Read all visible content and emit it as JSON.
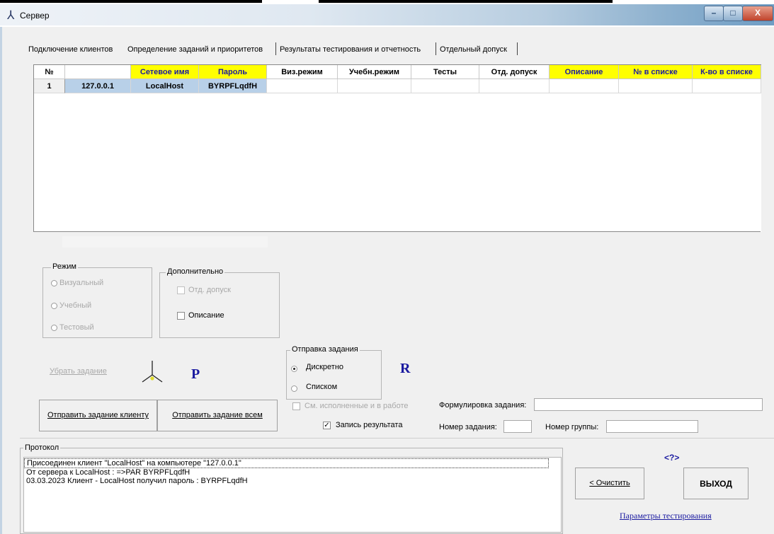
{
  "window": {
    "title": "Сервер",
    "controls": [
      "–",
      "□",
      "X"
    ]
  },
  "tabs": [
    "Подключение клиентов",
    "Определение заданий и приоритетов",
    "Результаты тестирования и отчетность",
    "Отдельный допуск"
  ],
  "grid": {
    "columns": [
      "№",
      "",
      "Сетевое имя",
      "Пароль",
      "Виз.режим",
      "Учебн.режим",
      "Тесты",
      "Отд. допуск",
      "Описание",
      "№ в списке",
      "К-во в списке"
    ],
    "highlighted_columns": [
      "Сетевое имя",
      "Пароль",
      "Описание",
      "№ в списке",
      "К-во в списке"
    ],
    "rows": [
      [
        "1",
        "127.0.0.1",
        "LocalHost",
        "BYRPFLqdfH",
        "",
        "",
        "",
        "",
        "",
        "",
        ""
      ]
    ]
  },
  "mode_group": {
    "legend": "Режим",
    "options": [
      "Визуальный",
      "Учебный",
      "Тестовый"
    ]
  },
  "extra_group": {
    "legend": "Дополнительно",
    "options": [
      "Отд. допуск",
      "Описание"
    ]
  },
  "send_group": {
    "legend": "Отправка задания",
    "options": [
      "Дискретно",
      "Списком"
    ],
    "selected": "Дискретно"
  },
  "remove_task_label": "Убрать задание",
  "p_marker": "P",
  "r_marker": "R",
  "send_client_button": "Отправить задание клиенту",
  "send_all_button": "Отправить задание всем",
  "show_done_checkbox": "См. исполненные и в работе",
  "record_result_checkbox": "Запись результата",
  "task_wording_label": "Формулировка задания:",
  "task_number_label": "Номер задания:",
  "group_number_label": "Номер группы:",
  "protocol": {
    "legend": "Протокол",
    "lines": [
      "Присоединен клиент \"LocalHost\" на компьютере \"127.0.0.1\"",
      " От сервера к LocalHost : =>PAR BYRPFLqdfH",
      "03.03.2023 Клиент - LocalHost получил пароль : BYRPFLqdfH"
    ]
  },
  "help_marker": "<?>",
  "clear_button": "< Очистить",
  "exit_button": "ВЫХОД",
  "test_params_link": "Параметры тестирования",
  "colors": {
    "header_yellow": "#ffff00",
    "selected_cell": "#b8d0e8",
    "accent_blue": "#1a1aa0"
  }
}
